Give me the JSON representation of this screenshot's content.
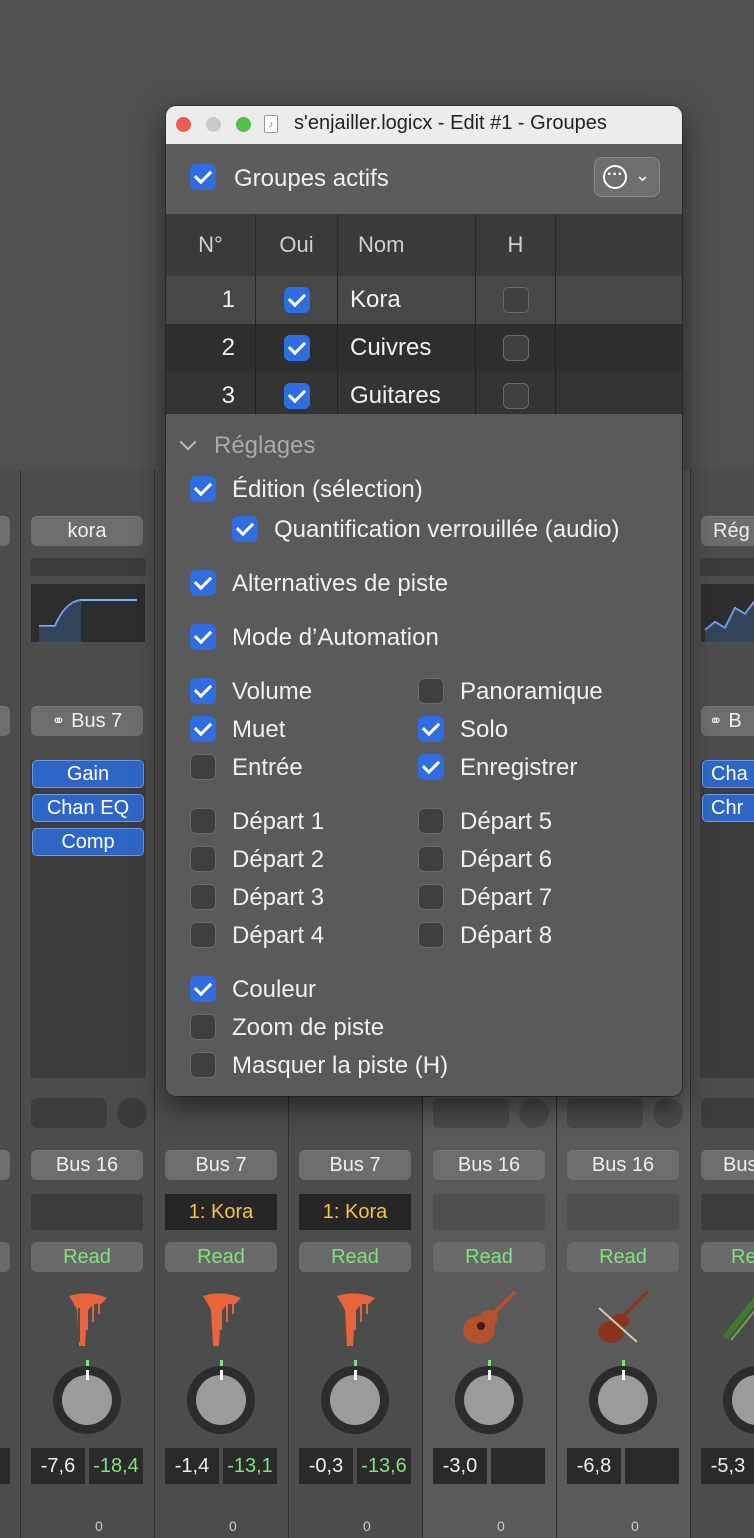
{
  "window": {
    "title": "s'enjailler.logicx - Edit #1 - Groupes",
    "doc_icon": "logic-doc-icon"
  },
  "header": {
    "groups_active_label": "Groupes actifs",
    "groups_active_checked": true,
    "actions_icon": "ellipsis-circle-icon"
  },
  "table": {
    "columns": [
      "N°",
      "Oui",
      "Nom",
      "H"
    ],
    "rows": [
      {
        "num": "1",
        "on": true,
        "name": "Kora",
        "hide": false
      },
      {
        "num": "2",
        "on": true,
        "name": "Cuivres",
        "hide": false
      },
      {
        "num": "3",
        "on": true,
        "name": "Guitares",
        "hide": false
      }
    ]
  },
  "settings": {
    "title": "Réglages",
    "edition": {
      "label": "Édition (sélection)",
      "checked": true
    },
    "quantize": {
      "label": "Quantification verrouillée (audio)",
      "checked": true
    },
    "alternatives": {
      "label": "Alternatives de piste",
      "checked": true
    },
    "automation": {
      "label": "Mode d’Automation",
      "checked": true
    },
    "volume": {
      "label": "Volume",
      "checked": true
    },
    "pan": {
      "label": "Panoramique",
      "checked": false
    },
    "mute": {
      "label": "Muet",
      "checked": true
    },
    "solo": {
      "label": "Solo",
      "checked": true
    },
    "input": {
      "label": "Entrée",
      "checked": false
    },
    "record": {
      "label": "Enregistrer",
      "checked": true
    },
    "sends": [
      {
        "label": "Départ 1",
        "checked": false
      },
      {
        "label": "Départ 2",
        "checked": false
      },
      {
        "label": "Départ 3",
        "checked": false
      },
      {
        "label": "Départ 4",
        "checked": false
      },
      {
        "label": "Départ 5",
        "checked": false
      },
      {
        "label": "Départ 6",
        "checked": false
      },
      {
        "label": "Départ 7",
        "checked": false
      },
      {
        "label": "Départ 8",
        "checked": false
      }
    ],
    "color": {
      "label": "Couleur",
      "checked": true
    },
    "zoom": {
      "label": "Zoom de piste",
      "checked": false
    },
    "hide_track": {
      "label": "Masquer la piste (H)",
      "checked": false
    }
  },
  "mixer": {
    "strip1": {
      "name": "kora",
      "output": "Bus 7",
      "plugins": [
        "Gain",
        "Chan EQ",
        "Comp"
      ],
      "bus": "Bus 16",
      "automation": "Read",
      "vol": "-7,6",
      "peak": "-18,4",
      "instrument_icon": "harp-icon"
    },
    "strip2": {
      "bus": "Bus 7",
      "group": "1: Kora",
      "automation": "Read",
      "vol": "-1,4",
      "peak": "-13,1",
      "instrument_icon": "harp-icon"
    },
    "strip3": {
      "bus": "Bus 7",
      "group": "1: Kora",
      "automation": "Read",
      "vol": "-0,3",
      "peak": "-13,6",
      "instrument_icon": "harp-icon"
    },
    "strip4": {
      "bus": "Bus 16",
      "automation": "Read",
      "vol": "-3,0",
      "instrument_icon": "acoustic-guitar-icon"
    },
    "strip5": {
      "bus": "Bus 16",
      "automation": "Read",
      "vol": "-6,8",
      "instrument_icon": "violin-icon"
    },
    "strip6": {
      "name": "Rég",
      "output": "B",
      "plugins": [
        "Cha",
        "Chr"
      ],
      "bus": "Bus",
      "automation": "Re",
      "vol": "-5,3",
      "instrument_icon": "trombone-icon"
    },
    "fader_zero": "0"
  },
  "colors": {
    "checkbox_on": "#2f6de0",
    "plugin_blue": "#2f66c6",
    "read_green": "#7fe27f",
    "group_yellow": "#f4c542",
    "harp_orange": "#e8643a"
  }
}
